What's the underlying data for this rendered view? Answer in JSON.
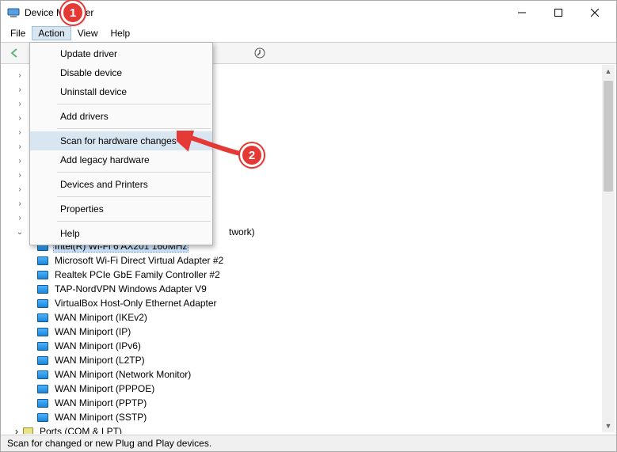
{
  "window": {
    "title": "Device Manager"
  },
  "menubar": {
    "file": "File",
    "action": "Action",
    "view": "View",
    "help": "Help"
  },
  "dropdown": {
    "update_driver": "Update driver",
    "disable_device": "Disable device",
    "uninstall_device": "Uninstall device",
    "add_drivers": "Add drivers",
    "scan_hardware": "Scan for hardware changes",
    "add_legacy": "Add legacy hardware",
    "devices_printers": "Devices and Printers",
    "properties": "Properties",
    "help": "Help"
  },
  "tree": {
    "visible_parent_suffix": "twork)",
    "devices": [
      "Intel(R) Wi-Fi 6 AX201 160MHz",
      "Microsoft Wi-Fi Direct Virtual Adapter #2",
      "Realtek PCIe GbE Family Controller #2",
      "TAP-NordVPN Windows Adapter V9",
      "VirtualBox Host-Only Ethernet Adapter",
      "WAN Miniport (IKEv2)",
      "WAN Miniport (IP)",
      "WAN Miniport (IPv6)",
      "WAN Miniport (L2TP)",
      "WAN Miniport (Network Monitor)",
      "WAN Miniport (PPPOE)",
      "WAN Miniport (PPTP)",
      "WAN Miniport (SSTP)"
    ],
    "ports_label": "Ports (COM & LPT)"
  },
  "statusbar": {
    "text": "Scan for changed or new Plug and Play devices."
  },
  "callouts": {
    "one": "1",
    "two": "2"
  }
}
